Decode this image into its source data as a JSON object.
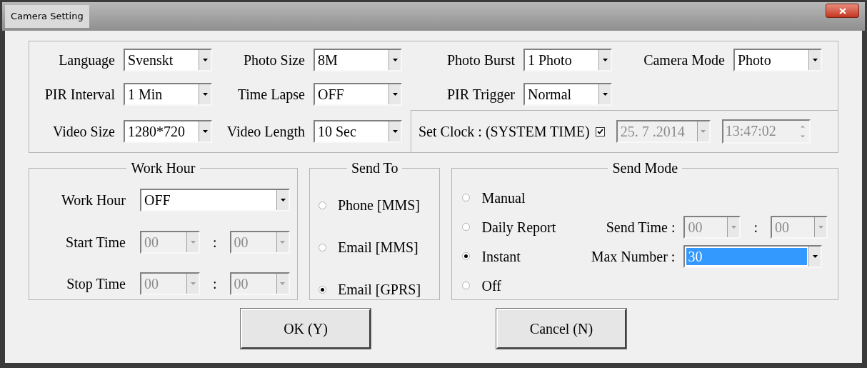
{
  "window": {
    "title": "Camera Setting"
  },
  "settings": [
    {
      "label": "Language",
      "value": "Svenskt"
    },
    {
      "label": "Photo Size",
      "value": "8M"
    },
    {
      "label": "Photo Burst",
      "value": "1 Photo"
    },
    {
      "label": "Camera Mode",
      "value": "Photo"
    },
    {
      "label": "PIR Interval",
      "value": "1 Min"
    },
    {
      "label": "Time Lapse",
      "value": "OFF"
    },
    {
      "label": "PIR Trigger",
      "value": "Normal"
    },
    {
      "label": "Video Size",
      "value": "1280*720"
    },
    {
      "label": "Video Length",
      "value": "10 Sec"
    }
  ],
  "set_clock": {
    "label": "Set Clock : (SYSTEM TIME)",
    "checked": true,
    "date": "25. 7 .2014",
    "time": "13:47:02",
    "disabled": true
  },
  "work_hour": {
    "title": "Work Hour",
    "mode": {
      "label": "Work Hour",
      "value": "OFF"
    },
    "times": [
      {
        "label": "Start Time",
        "hour": "00",
        "separator": ":",
        "minute": "00",
        "disabled": true
      },
      {
        "label": "Stop Time",
        "hour": "00",
        "separator": ":",
        "minute": "00",
        "disabled": true
      }
    ]
  },
  "send_to": {
    "title": "Send To",
    "options": [
      {
        "label": "Phone [MMS]",
        "selected": false
      },
      {
        "label": "Email [MMS]",
        "selected": false
      },
      {
        "label": "Email [GPRS]",
        "selected": true
      }
    ]
  },
  "send_mode": {
    "title": "Send Mode",
    "options": [
      {
        "label": "Manual",
        "selected": false
      },
      {
        "label": "Daily Report",
        "selected": false
      },
      {
        "label": "Instant",
        "selected": true
      },
      {
        "label": "Off",
        "selected": false
      }
    ],
    "send_time": {
      "label": "Send Time :",
      "hour": "00",
      "separator": ":",
      "minute": "00",
      "disabled": true
    },
    "max_number": {
      "label": "Max Number :",
      "value": "30",
      "highlighted": true
    }
  },
  "buttons": [
    {
      "label": "OK (Y)"
    },
    {
      "label": "Cancel (N)"
    }
  ]
}
